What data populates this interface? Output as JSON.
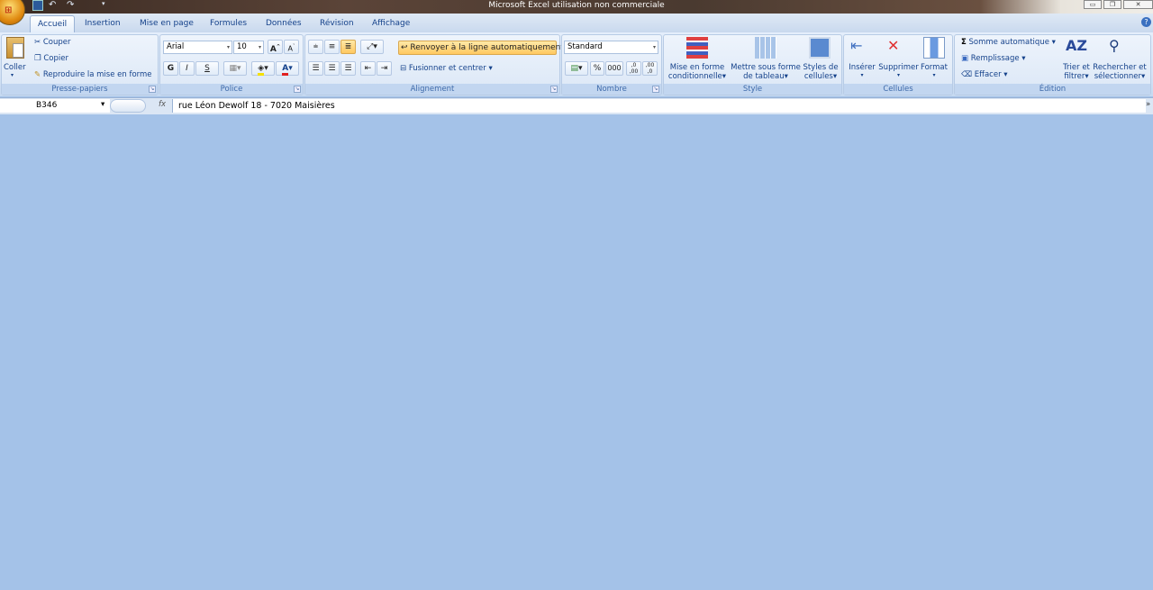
{
  "window": {
    "title": "Microsoft Excel utilisation non commerciale"
  },
  "tabs": [
    {
      "label": "Accueil",
      "active": true
    },
    {
      "label": "Insertion"
    },
    {
      "label": "Mise en page"
    },
    {
      "label": "Formules"
    },
    {
      "label": "Données"
    },
    {
      "label": "Révision"
    },
    {
      "label": "Affichage"
    }
  ],
  "clipboard": {
    "paste": "Coller",
    "cut": "Couper",
    "copy": "Copier",
    "format_painter": "Reproduire la mise en forme",
    "label": "Presse-papiers"
  },
  "font": {
    "name": "Arial",
    "size": "10",
    "bold": "G",
    "italic": "I",
    "underline": "S",
    "label": "Police",
    "font_color": "#e02020",
    "fill_color": "#f5e000"
  },
  "alignment": {
    "wrap_text": "Renvoyer à la ligne automatiquement",
    "merge_center": "Fusionner et centrer",
    "label": "Alignement"
  },
  "number": {
    "format": "Standard",
    "percent": "%",
    "thousands": "000",
    "inc_decimal": ",0 ,00",
    "dec_decimal": ",00 ,0",
    "label": "Nombre"
  },
  "style": {
    "conditional": [
      "Mise en forme",
      "conditionnelle"
    ],
    "table": [
      "Mettre sous forme",
      "de tableau"
    ],
    "cell_styles": [
      "Styles de",
      "cellules"
    ],
    "label": "Style"
  },
  "cells": {
    "insert": "Insérer",
    "delete": "Supprimer",
    "format": "Format",
    "label": "Cellules"
  },
  "editing": {
    "autosum": "Somme automatique",
    "fill": "Remplissage",
    "clear": "Effacer",
    "sort": [
      "Trier et",
      "filtrer"
    ],
    "find": [
      "Rechercher et",
      "sélectionner"
    ],
    "label": "Édition"
  },
  "formula_bar": {
    "name_box": "B346",
    "fx": "fx",
    "value": "rue Léon Dewolf 18 - 7020 Maisières"
  }
}
